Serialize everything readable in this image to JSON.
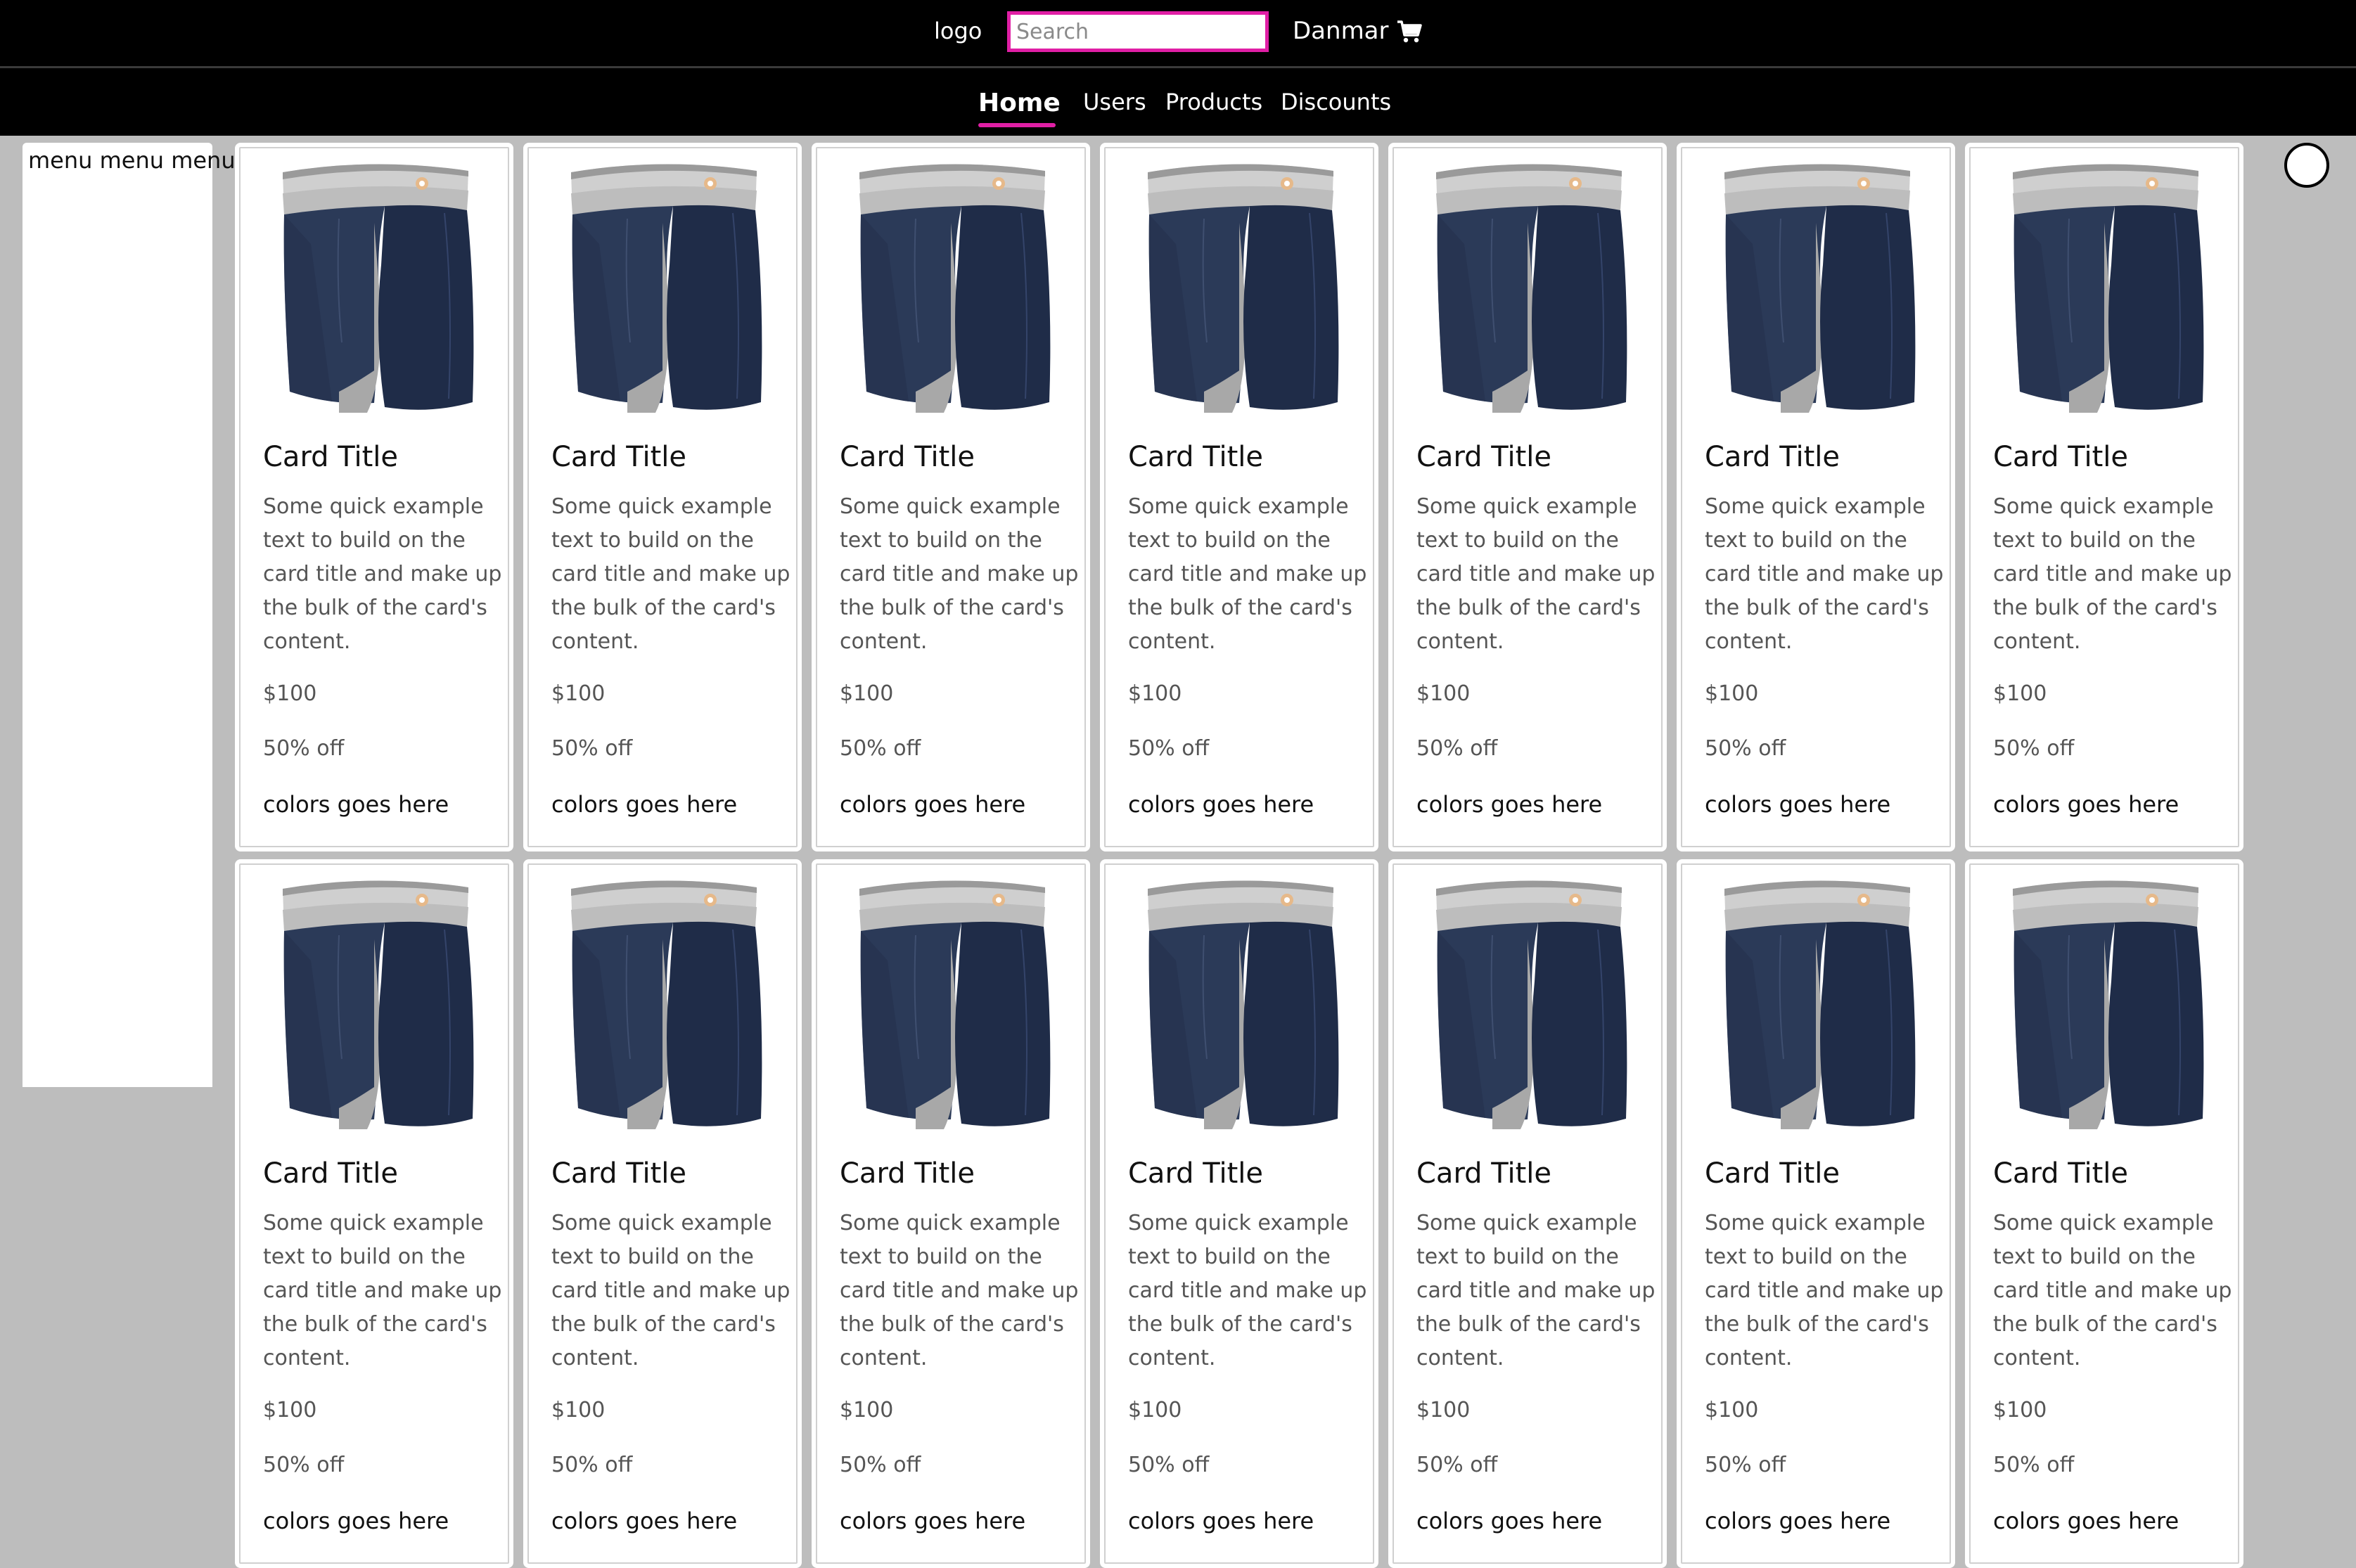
{
  "header": {
    "logo": "logo",
    "search_placeholder": "Search",
    "brand": "Danmar",
    "cart_icon": "shopping-cart-icon"
  },
  "nav": {
    "items": [
      {
        "label": "Home",
        "active": true
      },
      {
        "label": "Users"
      },
      {
        "label": "Products"
      },
      {
        "label": "Discounts"
      }
    ],
    "accent": "#e01fa5"
  },
  "sidebar": {
    "text": "menu menu menu"
  },
  "cards": [
    {
      "title": "Card Title",
      "text": "Some quick example text to build on the card title and make up the bulk of the card's content.",
      "price": "$100",
      "discount": "50% off",
      "colors": "colors goes here"
    },
    {
      "title": "Card Title",
      "text": "Some quick example text to build on the card title and make up the bulk of the card's content.",
      "price": "$100",
      "discount": "50% off",
      "colors": "colors goes here"
    },
    {
      "title": "Card Title",
      "text": "Some quick example text to build on the card title and make up the bulk of the card's content.",
      "price": "$100",
      "discount": "50% off",
      "colors": "colors goes here"
    },
    {
      "title": "Card Title",
      "text": "Some quick example text to build on the card title and make up the bulk of the card's content.",
      "price": "$100",
      "discount": "50% off",
      "colors": "colors goes here"
    },
    {
      "title": "Card Title",
      "text": "Some quick example text to build on the card title and make up the bulk of the card's content.",
      "price": "$100",
      "discount": "50% off",
      "colors": "colors goes here"
    },
    {
      "title": "Card Title",
      "text": "Some quick example text to build on the card title and make up the bulk of the card's content.",
      "price": "$100",
      "discount": "50% off",
      "colors": "colors goes here"
    },
    {
      "title": "Card Title",
      "text": "Some quick example text to build on the card title and make up the bulk of the card's content.",
      "price": "$100",
      "discount": "50% off",
      "colors": "colors goes here"
    },
    {
      "title": "Card Title",
      "text": "Some quick example text to build on the card title and make up the bulk of the card's content.",
      "price": "$100",
      "discount": "50% off",
      "colors": "colors goes here"
    },
    {
      "title": "Card Title",
      "text": "Some quick example text to build on the card title and make up the bulk of the card's content.",
      "price": "$100",
      "discount": "50% off",
      "colors": "colors goes here"
    },
    {
      "title": "Card Title",
      "text": "Some quick example text to build on the card title and make up the bulk of the card's content.",
      "price": "$100",
      "discount": "50% off",
      "colors": "colors goes here"
    },
    {
      "title": "Card Title",
      "text": "Some quick example text to build on the card title and make up the bulk of the card's content.",
      "price": "$100",
      "discount": "50% off",
      "colors": "colors goes here"
    },
    {
      "title": "Card Title",
      "text": "Some quick example text to build on the card title and make up the bulk of the card's content.",
      "price": "$100",
      "discount": "50% off",
      "colors": "colors goes here"
    },
    {
      "title": "Card Title",
      "text": "Some quick example text to build on the card title and make up the bulk of the card's content.",
      "price": "$100",
      "discount": "50% off",
      "colors": "colors goes here"
    },
    {
      "title": "Card Title",
      "text": "Some quick example text to build on the card title and make up the bulk of the card's content.",
      "price": "$100",
      "discount": "50% off",
      "colors": "colors goes here"
    }
  ],
  "product_image_icon": "boxer-briefs-image"
}
